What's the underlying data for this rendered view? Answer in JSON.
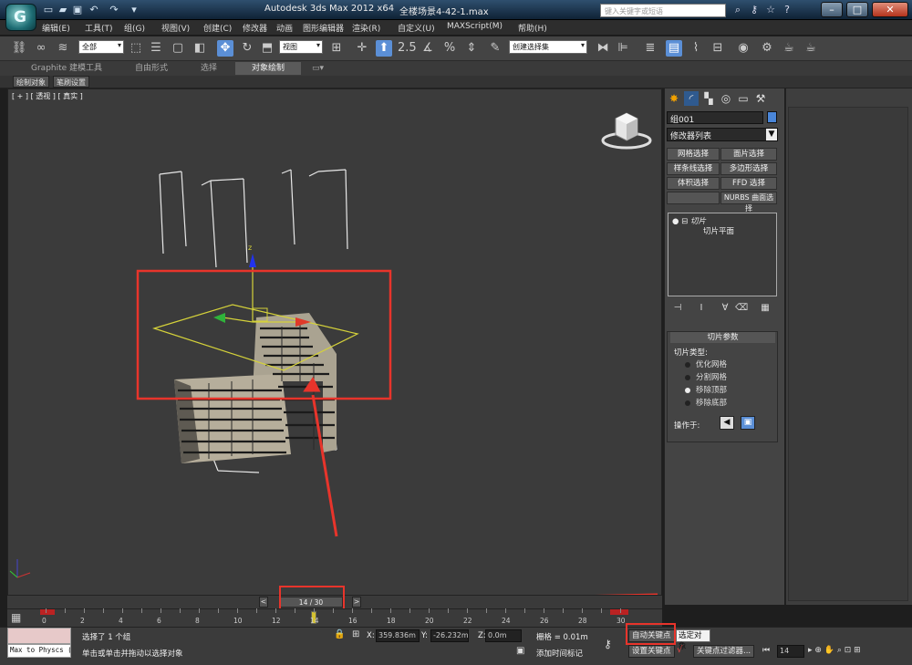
{
  "window": {
    "app_title": "Autodesk 3ds Max  2012 x64",
    "file_title": "全楼场景4-42-1.max",
    "search_placeholder": "键入关键字或短语"
  },
  "menu": [
    "编辑(E)",
    "工具(T)",
    "组(G)",
    "视图(V)",
    "创建(C)",
    "修改器",
    "动画",
    "图形编辑器",
    "渲染(R)",
    "自定义(U)",
    "MAXScript(M)",
    "帮助(H)"
  ],
  "toolbar": {
    "filter_combo": "全部",
    "view_combo": "视图",
    "selection_set_combo": "创建选择集",
    "snap_value": "2.5"
  },
  "ribbon": {
    "tabs": [
      "Graphite 建模工具",
      "自由形式",
      "选择",
      "对象绘制"
    ],
    "active_tab": "对象绘制",
    "sub_buttons": [
      "绘制对象",
      "笔刷设置"
    ]
  },
  "viewport": {
    "label": "[ + ] [ 透视 ] [ 真实 ]"
  },
  "command_panel": {
    "object_name": "组001",
    "object_color": "#4a86d9",
    "modifier_list": "修改器列表",
    "modifier_buttons": [
      "网格选择",
      "面片选择",
      "样条线选择",
      "多边形选择",
      "体积选择",
      "FFD 选择",
      "",
      "NURBS 曲面选择"
    ],
    "stack": [
      {
        "label": "切片"
      },
      {
        "label": "切片平面"
      }
    ],
    "rollout_title": "切片参数",
    "slice_type_label": "切片类型:",
    "slice_types": [
      {
        "label": "优化网格",
        "selected": false
      },
      {
        "label": "分割网格",
        "selected": false
      },
      {
        "label": "移除顶部",
        "selected": true
      },
      {
        "label": "移除底部",
        "selected": false
      }
    ],
    "operate_on_label": "操作于:"
  },
  "timeline": {
    "frame_display": "14 / 30",
    "current_frame": 14,
    "total_frames": 30,
    "tick_labels": [
      "0",
      "2",
      "4",
      "6",
      "8",
      "10",
      "12",
      "14",
      "16",
      "18",
      "20",
      "22",
      "24",
      "26",
      "28",
      "30"
    ]
  },
  "status": {
    "listener_text": "Max to Physcs (",
    "selection_info": "选择了 1 个组",
    "prompt": "单击或单击并拖动以选择对象",
    "x_label": "X:",
    "x_value": "359.836m",
    "y_label": "Y:",
    "y_value": "-26.232m",
    "z_label": "Z:",
    "z_value": "0.0m",
    "grid": "栅格 = 0.01m",
    "add_time_tag": "添加时间标记",
    "auto_key": "自动关键点",
    "set_key": "设置关键点",
    "selected_tooltip": "选定对象",
    "key_filters": "关键点过滤器...",
    "frame_field": "14"
  },
  "colors": {
    "highlight": "#e8342b",
    "slice_plane": "#d5d23a",
    "accent": "#5b8fd6"
  }
}
